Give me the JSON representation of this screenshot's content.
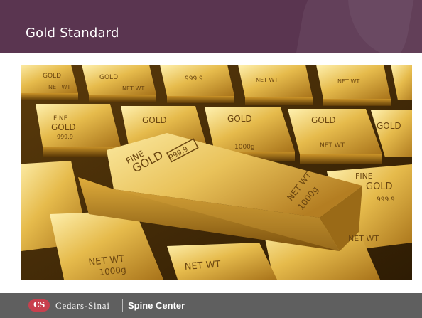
{
  "slide": {
    "title": "Gold Standard",
    "image_description_label": "Gold bars"
  },
  "bars": {
    "fine": "FINE",
    "gold": "GOLD",
    "purity": "999.9",
    "net": "NET WT",
    "weight": "1000g"
  },
  "footer": {
    "logo_monogram": "CS",
    "brand": "Cedars-Sinai",
    "department": "Spine Center"
  },
  "colors": {
    "title_bar": "#5a3550",
    "footer_bar": "#5f5f5f",
    "logo": "#c8404e",
    "gold_light": "#f7df8a",
    "gold_mid": "#d9a935",
    "gold_dark": "#7a4f0c"
  }
}
